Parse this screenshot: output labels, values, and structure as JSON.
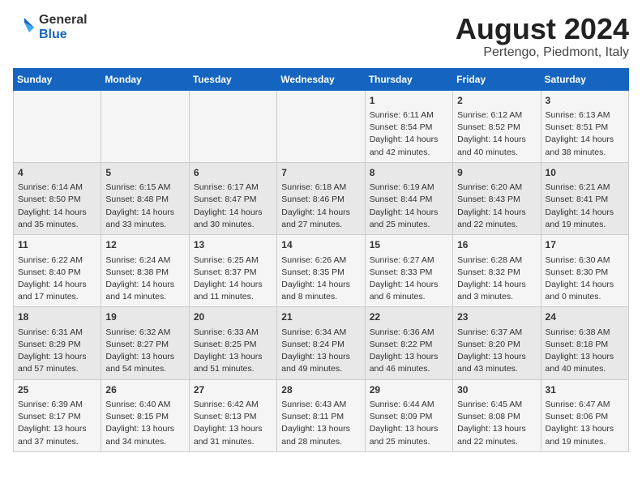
{
  "logo": {
    "general": "General",
    "blue": "Blue"
  },
  "title": "August 2024",
  "location": "Pertengo, Piedmont, Italy",
  "days_of_week": [
    "Sunday",
    "Monday",
    "Tuesday",
    "Wednesday",
    "Thursday",
    "Friday",
    "Saturday"
  ],
  "weeks": [
    [
      {
        "day": "",
        "info": ""
      },
      {
        "day": "",
        "info": ""
      },
      {
        "day": "",
        "info": ""
      },
      {
        "day": "",
        "info": ""
      },
      {
        "day": "1",
        "info": "Sunrise: 6:11 AM\nSunset: 8:54 PM\nDaylight: 14 hours\nand 42 minutes."
      },
      {
        "day": "2",
        "info": "Sunrise: 6:12 AM\nSunset: 8:52 PM\nDaylight: 14 hours\nand 40 minutes."
      },
      {
        "day": "3",
        "info": "Sunrise: 6:13 AM\nSunset: 8:51 PM\nDaylight: 14 hours\nand 38 minutes."
      }
    ],
    [
      {
        "day": "4",
        "info": "Sunrise: 6:14 AM\nSunset: 8:50 PM\nDaylight: 14 hours\nand 35 minutes."
      },
      {
        "day": "5",
        "info": "Sunrise: 6:15 AM\nSunset: 8:48 PM\nDaylight: 14 hours\nand 33 minutes."
      },
      {
        "day": "6",
        "info": "Sunrise: 6:17 AM\nSunset: 8:47 PM\nDaylight: 14 hours\nand 30 minutes."
      },
      {
        "day": "7",
        "info": "Sunrise: 6:18 AM\nSunset: 8:46 PM\nDaylight: 14 hours\nand 27 minutes."
      },
      {
        "day": "8",
        "info": "Sunrise: 6:19 AM\nSunset: 8:44 PM\nDaylight: 14 hours\nand 25 minutes."
      },
      {
        "day": "9",
        "info": "Sunrise: 6:20 AM\nSunset: 8:43 PM\nDaylight: 14 hours\nand 22 minutes."
      },
      {
        "day": "10",
        "info": "Sunrise: 6:21 AM\nSunset: 8:41 PM\nDaylight: 14 hours\nand 19 minutes."
      }
    ],
    [
      {
        "day": "11",
        "info": "Sunrise: 6:22 AM\nSunset: 8:40 PM\nDaylight: 14 hours\nand 17 minutes."
      },
      {
        "day": "12",
        "info": "Sunrise: 6:24 AM\nSunset: 8:38 PM\nDaylight: 14 hours\nand 14 minutes."
      },
      {
        "day": "13",
        "info": "Sunrise: 6:25 AM\nSunset: 8:37 PM\nDaylight: 14 hours\nand 11 minutes."
      },
      {
        "day": "14",
        "info": "Sunrise: 6:26 AM\nSunset: 8:35 PM\nDaylight: 14 hours\nand 8 minutes."
      },
      {
        "day": "15",
        "info": "Sunrise: 6:27 AM\nSunset: 8:33 PM\nDaylight: 14 hours\nand 6 minutes."
      },
      {
        "day": "16",
        "info": "Sunrise: 6:28 AM\nSunset: 8:32 PM\nDaylight: 14 hours\nand 3 minutes."
      },
      {
        "day": "17",
        "info": "Sunrise: 6:30 AM\nSunset: 8:30 PM\nDaylight: 14 hours\nand 0 minutes."
      }
    ],
    [
      {
        "day": "18",
        "info": "Sunrise: 6:31 AM\nSunset: 8:29 PM\nDaylight: 13 hours\nand 57 minutes."
      },
      {
        "day": "19",
        "info": "Sunrise: 6:32 AM\nSunset: 8:27 PM\nDaylight: 13 hours\nand 54 minutes."
      },
      {
        "day": "20",
        "info": "Sunrise: 6:33 AM\nSunset: 8:25 PM\nDaylight: 13 hours\nand 51 minutes."
      },
      {
        "day": "21",
        "info": "Sunrise: 6:34 AM\nSunset: 8:24 PM\nDaylight: 13 hours\nand 49 minutes."
      },
      {
        "day": "22",
        "info": "Sunrise: 6:36 AM\nSunset: 8:22 PM\nDaylight: 13 hours\nand 46 minutes."
      },
      {
        "day": "23",
        "info": "Sunrise: 6:37 AM\nSunset: 8:20 PM\nDaylight: 13 hours\nand 43 minutes."
      },
      {
        "day": "24",
        "info": "Sunrise: 6:38 AM\nSunset: 8:18 PM\nDaylight: 13 hours\nand 40 minutes."
      }
    ],
    [
      {
        "day": "25",
        "info": "Sunrise: 6:39 AM\nSunset: 8:17 PM\nDaylight: 13 hours\nand 37 minutes."
      },
      {
        "day": "26",
        "info": "Sunrise: 6:40 AM\nSunset: 8:15 PM\nDaylight: 13 hours\nand 34 minutes."
      },
      {
        "day": "27",
        "info": "Sunrise: 6:42 AM\nSunset: 8:13 PM\nDaylight: 13 hours\nand 31 minutes."
      },
      {
        "day": "28",
        "info": "Sunrise: 6:43 AM\nSunset: 8:11 PM\nDaylight: 13 hours\nand 28 minutes."
      },
      {
        "day": "29",
        "info": "Sunrise: 6:44 AM\nSunset: 8:09 PM\nDaylight: 13 hours\nand 25 minutes."
      },
      {
        "day": "30",
        "info": "Sunrise: 6:45 AM\nSunset: 8:08 PM\nDaylight: 13 hours\nand 22 minutes."
      },
      {
        "day": "31",
        "info": "Sunrise: 6:47 AM\nSunset: 8:06 PM\nDaylight: 13 hours\nand 19 minutes."
      }
    ]
  ]
}
